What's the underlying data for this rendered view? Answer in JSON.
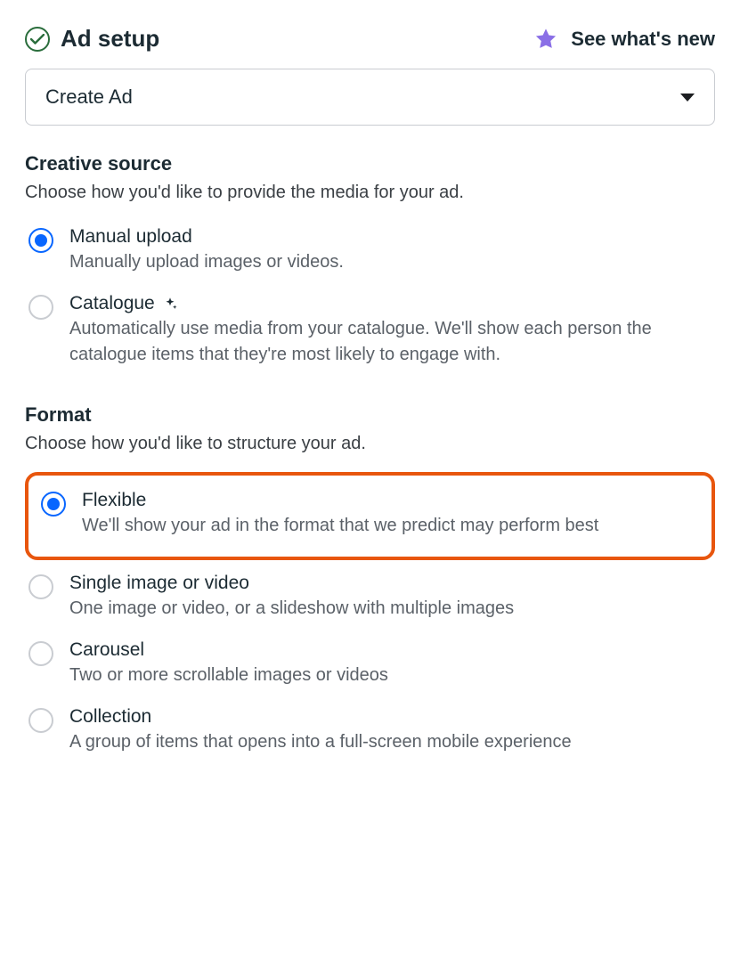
{
  "header": {
    "title": "Ad setup",
    "whats_new": "See what's new"
  },
  "dropdown": {
    "selected": "Create Ad"
  },
  "creative_source": {
    "title": "Creative source",
    "subtitle": "Choose how you'd like to provide the media for your ad.",
    "options": {
      "manual": {
        "label": "Manual upload",
        "desc": "Manually upload images or videos."
      },
      "catalogue": {
        "label": "Catalogue",
        "desc": "Automatically use media from your catalogue. We'll show each person the catalogue items that they're most likely to engage with."
      }
    }
  },
  "format": {
    "title": "Format",
    "subtitle": "Choose how you'd like to structure your ad.",
    "options": {
      "flexible": {
        "label": "Flexible",
        "desc": "We'll show your ad in the format that we predict may perform best"
      },
      "single": {
        "label": "Single image or video",
        "desc": "One image or video, or a slideshow with multiple images"
      },
      "carousel": {
        "label": "Carousel",
        "desc": "Two or more scrollable images or videos"
      },
      "collection": {
        "label": "Collection",
        "desc": "A group of items that opens into a full-screen mobile experience"
      }
    }
  }
}
